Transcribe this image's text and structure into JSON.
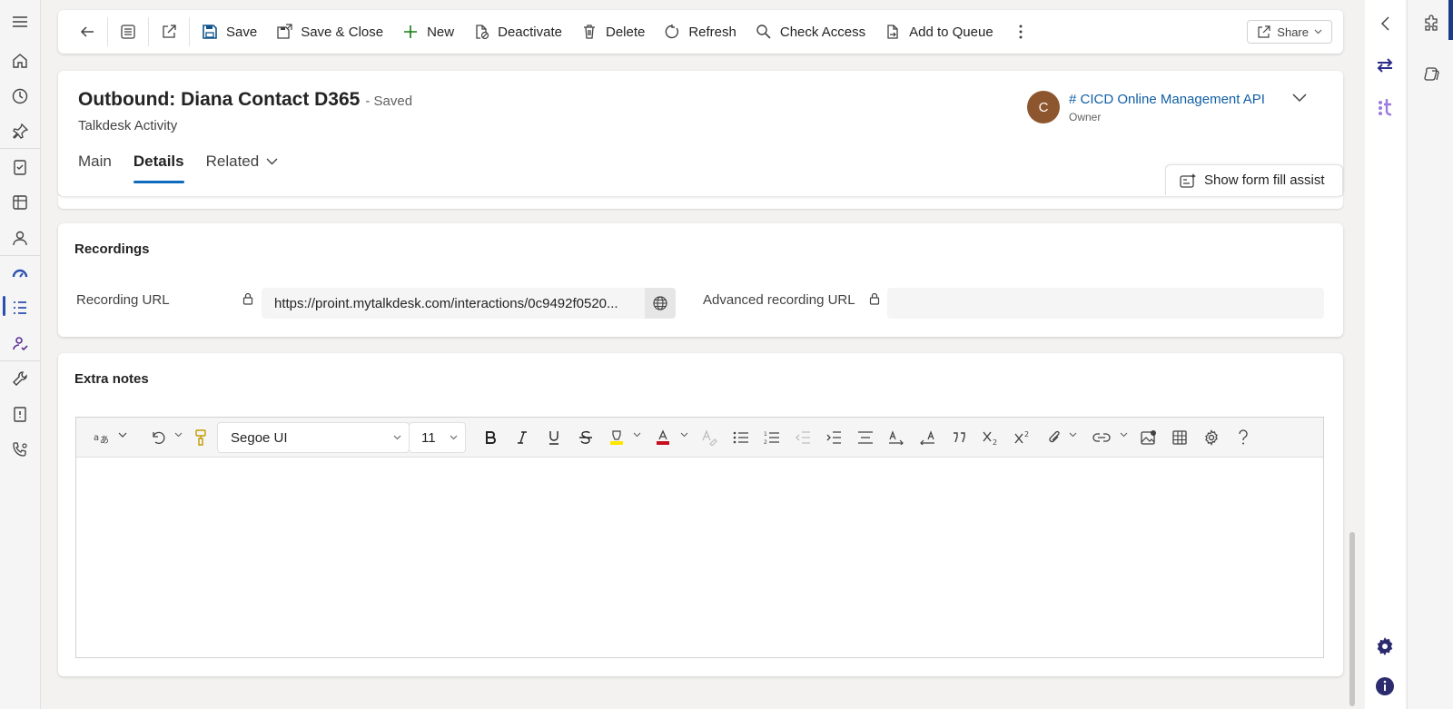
{
  "commandbar": {
    "save": "Save",
    "save_close": "Save & Close",
    "new": "New",
    "deactivate": "Deactivate",
    "delete": "Delete",
    "refresh": "Refresh",
    "check_access": "Check Access",
    "add_to_queue": "Add to Queue",
    "share": "Share"
  },
  "header": {
    "title": "Outbound: Diana Contact D365",
    "saved_status": "- Saved",
    "entity": "Talkdesk Activity",
    "owner_initial": "C",
    "owner_name": "# CICD Online Management API",
    "owner_label": "Owner",
    "form_fill_assist": "Show form fill assist"
  },
  "tabs": [
    {
      "label": "Main",
      "active": false
    },
    {
      "label": "Details",
      "active": true
    },
    {
      "label": "Related",
      "active": false
    }
  ],
  "recordings": {
    "title": "Recordings",
    "recording_url_label": "Recording URL",
    "recording_url_value": "https://proint.mytalkdesk.com/interactions/0c9492f0520...",
    "advanced_url_label": "Advanced recording URL",
    "advanced_url_value": ""
  },
  "extra_notes": {
    "title": "Extra notes",
    "font": "Segoe UI",
    "font_size": "11"
  },
  "colors": {
    "accent": "#0f6cbd",
    "owner_link": "#115ea3",
    "avatar": "#8e562e",
    "nav_active": "#2b4fae",
    "highlight": "#ffe500",
    "font_color": "#c50f1f"
  }
}
